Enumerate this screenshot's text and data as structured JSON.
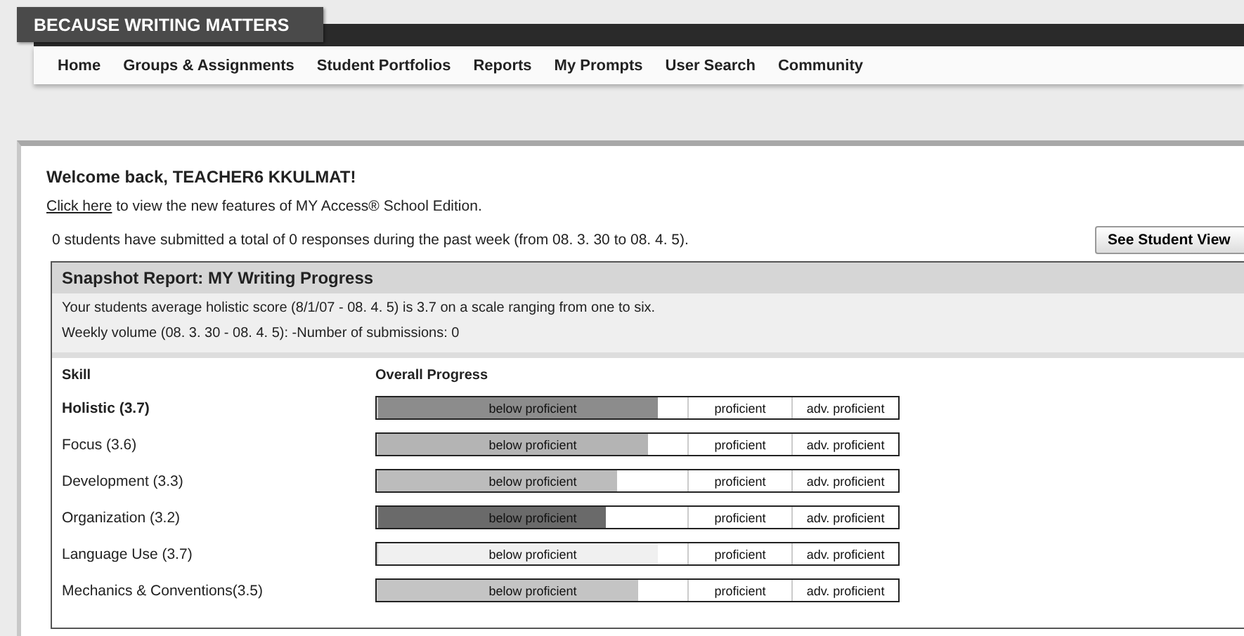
{
  "logo": "BECAUSE WRITING MATTERS",
  "nav": [
    {
      "label": "Home"
    },
    {
      "label": "Groups & Assignments"
    },
    {
      "label": "Student Portfolios"
    },
    {
      "label": "Reports"
    },
    {
      "label": "My Prompts"
    },
    {
      "label": "User Search"
    },
    {
      "label": "Community"
    }
  ],
  "welcome": "Welcome back, TEACHER6 KKULMAT!",
  "features": {
    "link": "Click here",
    "text": " to view the new features of MY Access® School Edition."
  },
  "summary": "0 students have submitted a total of 0 responses during the past week (from 08. 3. 30 to 08. 4. 5).",
  "student_view_button": "See Student View",
  "report": {
    "title": "Snapshot Report: MY Writing Progress",
    "lines": [
      "Your students average holistic score (8/1/07 - 08. 4. 5) is 3.7 on a scale ranging from one to six.",
      "Weekly volume (08. 3. 30 - 08. 4. 5): -Number of submissions: 0"
    ],
    "columns": [
      "Skill",
      "Overall Progress"
    ],
    "rows": [
      {
        "skill": "Holistic (3.7)",
        "kind": "overall",
        "level": 0.54,
        "color": "#8c8c8c",
        "bands": [
          "below proficient",
          "proficient",
          "adv. proficient"
        ]
      },
      {
        "skill": "Focus (3.6)",
        "kind": "skill",
        "level": 0.52,
        "color": "#b4b4b4",
        "bands": [
          "below proficient",
          "proficient",
          "adv. proficient"
        ]
      },
      {
        "skill": "Development (3.3)",
        "kind": "skill",
        "level": 0.46,
        "color": "#bcbcbc",
        "bands": [
          "below proficient",
          "proficient",
          "adv. proficient"
        ]
      },
      {
        "skill": "Organization (3.2)",
        "kind": "skill",
        "level": 0.44,
        "color": "#6a6a6a",
        "bands": [
          "below proficient",
          "proficient",
          "adv. proficient"
        ]
      },
      {
        "skill": "Language Use (3.7)",
        "kind": "skill",
        "level": 0.54,
        "color": "#f0f0f0",
        "bands": [
          "below proficient",
          "proficient",
          "adv. proficient"
        ]
      },
      {
        "skill": "Mechanics & Conventions(3.5)",
        "kind": "skill",
        "level": 0.5,
        "color": "#c4c4c4",
        "bands": [
          "below proficient",
          "proficient",
          "adv. proficient"
        ]
      }
    ]
  }
}
